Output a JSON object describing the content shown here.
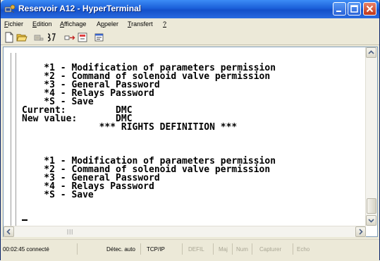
{
  "window": {
    "title": "Reservoir A12 - HyperTerminal"
  },
  "menu": {
    "items": [
      "Fichier",
      "Edition",
      "Affichage",
      "Appeler",
      "Transfert",
      "?"
    ],
    "mnemonics": [
      "F",
      "E",
      "A",
      "p",
      "T",
      "?"
    ]
  },
  "toolbar": {
    "icons": [
      "new-icon",
      "open-icon",
      "disconnect-icon",
      "dial-icon",
      "send-icon",
      "receive-icon",
      "properties-icon"
    ]
  },
  "terminal": {
    "lines": [
      "    *1 - Modification of parameters permission",
      "    *2 - Command of solenoid valve permission",
      "    *3 - General Password",
      "    *4 - Relays Password",
      "    *S - Save",
      "Current:         DMC",
      "New value:       DMC",
      "              *** RIGHTS DEFINITION ***",
      "",
      "    *1 - Modification of parameters permission",
      "    *2 - Command of solenoid valve permission",
      "    *3 - General Password",
      "    *4 - Relays Password",
      "    *S - Save"
    ]
  },
  "statusbar": {
    "time": "00:02:45 connecté",
    "detect": "Détec. auto",
    "protocol": "TCP/IP",
    "defil": "DEFIL",
    "maj": "Maj",
    "num": "Num",
    "capturer": "Capturer",
    "echo": "Echo"
  }
}
